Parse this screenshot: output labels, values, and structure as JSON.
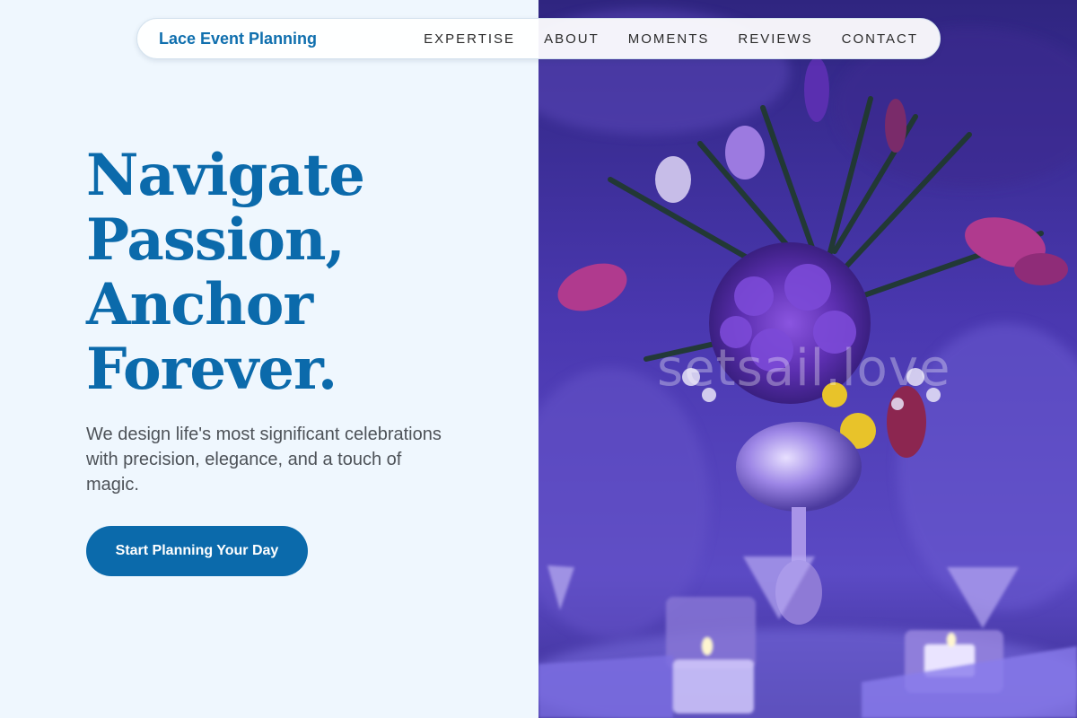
{
  "brand": {
    "name": "Lace Event Planning"
  },
  "nav": {
    "items": [
      {
        "label": "EXPERTISE"
      },
      {
        "label": "ABOUT"
      },
      {
        "label": "MOMENTS"
      },
      {
        "label": "REVIEWS"
      },
      {
        "label": "CONTACT"
      }
    ]
  },
  "hero": {
    "headline_lines": [
      "Navigate",
      "Passion,",
      "Anchor",
      "Forever."
    ],
    "subtitle": "We design life's most significant celebrations with precision, elegance, and a touch of magic.",
    "cta_label": "Start Planning Your Day",
    "image_watermark": "setsail.love"
  },
  "colors": {
    "accent": "#0b6aab",
    "background": "#eff7fe",
    "body_text": "#4d5258"
  }
}
